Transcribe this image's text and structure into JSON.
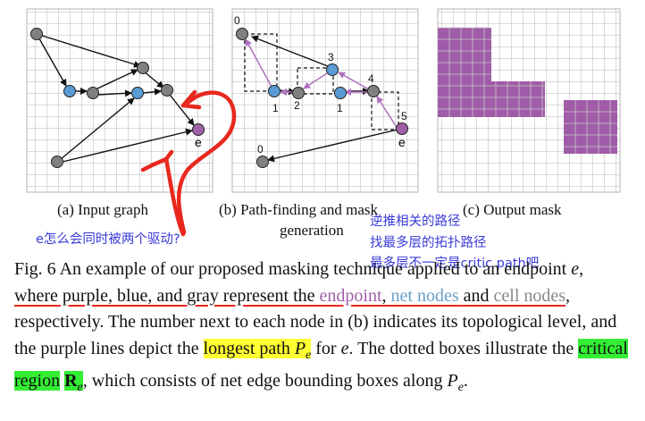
{
  "subcaptions": {
    "a": "(a) Input graph",
    "b_line1": "(b) Path-finding and mask",
    "b_line2": "generation",
    "c": "(c) Output mask"
  },
  "levels": {
    "l0_top": "0",
    "l3": "3",
    "l4": "4",
    "l5": "5",
    "l1_left": "1",
    "l2": "2",
    "l1_right": "1",
    "l0_bottom": "0"
  },
  "node_labels": {
    "e_a": "e",
    "e_b": "e"
  },
  "annotations": {
    "question": "e怎么会同时被两个驱动?",
    "note1": "逆推相关的路径",
    "note2": "找最多层的拓扑路径",
    "note3": "最多层不一定是critic path吧"
  },
  "caption": {
    "t1": "Fig. 6 An example of our proposed masking technique applied to an endpoint ",
    "e1": "e",
    "t2": ", ",
    "t3": "where purple, blue, and gray represent the ",
    "endpoint": "endpoint",
    "comma": ",",
    "net_nodes": "net nodes",
    "and": " and ",
    "cell_nodes": "cell nodes",
    "t4": ", respectively. The number next to each node in (b) indicates its topological level, and the purple lines depict the ",
    "longest_path": "longest path ",
    "pe": "P",
    "pe_sub": "e",
    "t5": " for ",
    "e2": "e",
    "t6": ". The dotted boxes illustrate the ",
    "critical_region": "critical region",
    "re": "R",
    "re_sub": "e",
    "t7": ", which consists of net edge bounding boxes along ",
    "pe2": "P",
    "pe2_sub": "e",
    "t8": "."
  },
  "colors": {
    "endpoint": "#a060a8",
    "net_node": "#5b9bd5",
    "cell_node": "#808080",
    "mask_fill": "#a05ca8",
    "pen": "#e8281e",
    "highlight_yellow": "#ffff33",
    "highlight_green": "#33ee33",
    "handwriting": "#3a3ad8"
  }
}
